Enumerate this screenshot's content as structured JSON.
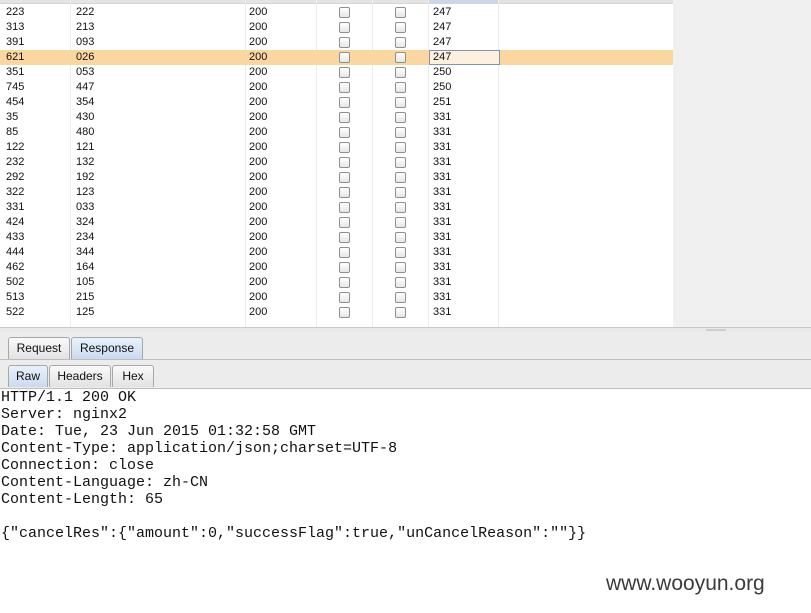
{
  "results_table": {
    "rows": [
      {
        "c1": "223",
        "c2": "222",
        "status": "200",
        "length": "247",
        "selected": false
      },
      {
        "c1": "313",
        "c2": "213",
        "status": "200",
        "length": "247",
        "selected": false
      },
      {
        "c1": "391",
        "c2": "093",
        "status": "200",
        "length": "247",
        "selected": false
      },
      {
        "c1": "621",
        "c2": "026",
        "status": "200",
        "length": "247",
        "selected": true
      },
      {
        "c1": "351",
        "c2": "053",
        "status": "200",
        "length": "250",
        "selected": false
      },
      {
        "c1": "745",
        "c2": "447",
        "status": "200",
        "length": "250",
        "selected": false
      },
      {
        "c1": "454",
        "c2": "354",
        "status": "200",
        "length": "251",
        "selected": false
      },
      {
        "c1": "35",
        "c2": "430",
        "status": "200",
        "length": "331",
        "selected": false
      },
      {
        "c1": "85",
        "c2": "480",
        "status": "200",
        "length": "331",
        "selected": false
      },
      {
        "c1": "122",
        "c2": "121",
        "status": "200",
        "length": "331",
        "selected": false
      },
      {
        "c1": "232",
        "c2": "132",
        "status": "200",
        "length": "331",
        "selected": false
      },
      {
        "c1": "292",
        "c2": "192",
        "status": "200",
        "length": "331",
        "selected": false
      },
      {
        "c1": "322",
        "c2": "123",
        "status": "200",
        "length": "331",
        "selected": false
      },
      {
        "c1": "331",
        "c2": "033",
        "status": "200",
        "length": "331",
        "selected": false
      },
      {
        "c1": "424",
        "c2": "324",
        "status": "200",
        "length": "331",
        "selected": false
      },
      {
        "c1": "433",
        "c2": "234",
        "status": "200",
        "length": "331",
        "selected": false
      },
      {
        "c1": "444",
        "c2": "344",
        "status": "200",
        "length": "331",
        "selected": false
      },
      {
        "c1": "462",
        "c2": "164",
        "status": "200",
        "length": "331",
        "selected": false
      },
      {
        "c1": "502",
        "c2": "105",
        "status": "200",
        "length": "331",
        "selected": false
      },
      {
        "c1": "513",
        "c2": "215",
        "status": "200",
        "length": "331",
        "selected": false
      },
      {
        "c1": "522",
        "c2": "125",
        "status": "200",
        "length": "331",
        "selected": false
      }
    ]
  },
  "message_tabs": {
    "request": "Request",
    "response": "Response",
    "active": "response"
  },
  "view_tabs": {
    "raw": "Raw",
    "headers": "Headers",
    "hex": "Hex",
    "active": "raw"
  },
  "response": {
    "status_line": "HTTP/1.1 200 OK",
    "headers": [
      "Server: nginx2",
      "Date: Tue, 23 Jun 2015 01:32:58 GMT",
      "Content-Type: application/json;charset=UTF-8",
      "Connection: close",
      "Content-Language: zh-CN",
      "Content-Length: 65"
    ],
    "body": "{\"cancelRes\":{\"amount\":0,\"successFlag\":true,\"unCancelReason\":\"\"}}"
  },
  "watermark": "www.wooyun.org",
  "colors": {
    "selected_row": "#fad7a0",
    "active_tab": "#c9dbef"
  }
}
